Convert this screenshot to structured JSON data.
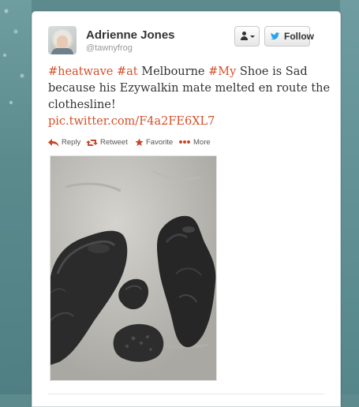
{
  "user": {
    "name": "Adrienne Jones",
    "handle": "@tawnyfrog"
  },
  "buttons": {
    "follow_label": "Follow",
    "user_actions_icon": "user-dropdown-icon"
  },
  "tweet": {
    "tag_heatwave": "#heatwave",
    "tag_at": "#at",
    "word_melbourne": " Melbourne ",
    "tag_my": "#My",
    "text_rest": " Shoe is Sad because his Ezywalkin mate melted en route the clothesline!",
    "link": "pic.twitter.com/F4a2FE6XL7"
  },
  "actions": {
    "reply": "Reply",
    "retweet": "Retweet",
    "favorite": "Favorite",
    "more": "More"
  },
  "colors": {
    "accent": "#d3502a",
    "twitter_blue": "#2aa3ef",
    "background": "#5d8a8d"
  }
}
